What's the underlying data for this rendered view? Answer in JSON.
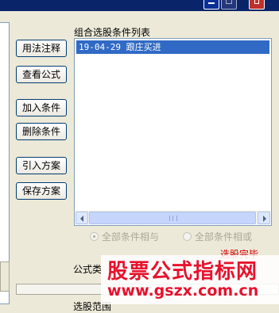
{
  "buttons": {
    "usage_notes": "用法注释",
    "view_formula": "查看公式",
    "add_condition": "加入条件",
    "delete_condition": "删除条件",
    "import_scheme": "引入方案",
    "save_scheme": "保存方案"
  },
  "condition_list": {
    "title": "组合选股条件列表",
    "items": [
      "19-04-29 跟庄买进"
    ]
  },
  "radios": {
    "all_and": "全部条件相与",
    "all_or": "全部条件相或",
    "selected": "all_and"
  },
  "status_text": "选股完毕",
  "formula_label": "公式类",
  "bottom_label": "选股范围",
  "watermark": {
    "title": "股票公式指标网",
    "url": "www.gszx.com.cn"
  },
  "colors": {
    "accent": "#316ac5",
    "status": "#d40000",
    "watermark": "#e8112d"
  }
}
